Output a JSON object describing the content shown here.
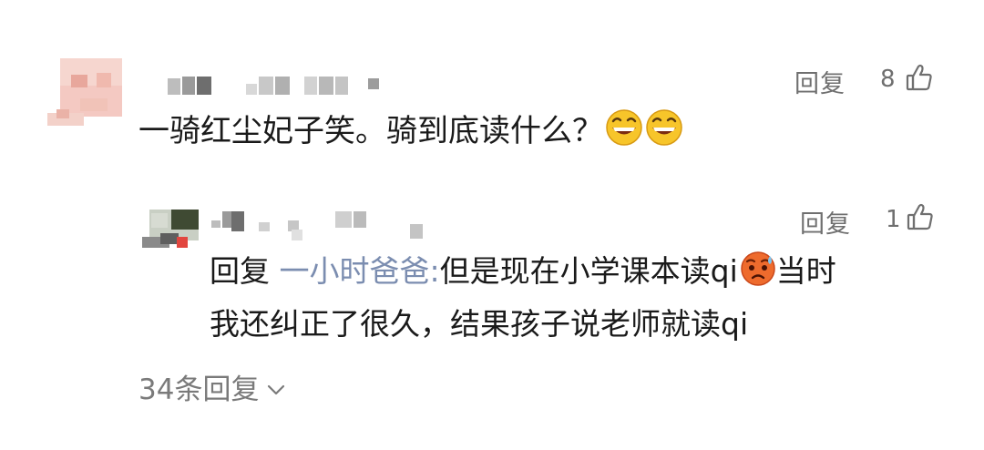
{
  "comment": {
    "text": "一骑红尘妃子笑。骑到底读什么？",
    "reply_label": "回复",
    "like_count": "8",
    "emojis": [
      "grinning-face-emoji",
      "grinning-face-emoji"
    ]
  },
  "reply": {
    "reply_label": "回复",
    "like_count": "1",
    "prefix": "回复",
    "target_user": "一小时爸爸:",
    "text_line1": "但是现在小学课本读qi",
    "emoji": "worried-face-emoji",
    "text_line1_tail": "当时",
    "text_line2": "我还纠正了很久，结果孩子说老师就读qi"
  },
  "more_replies": {
    "label": "34条回复"
  },
  "colors": {
    "text": "#1a1a1a",
    "secondary": "#6f6f6f",
    "link": "#7b8db0",
    "background": "#ffffff"
  }
}
